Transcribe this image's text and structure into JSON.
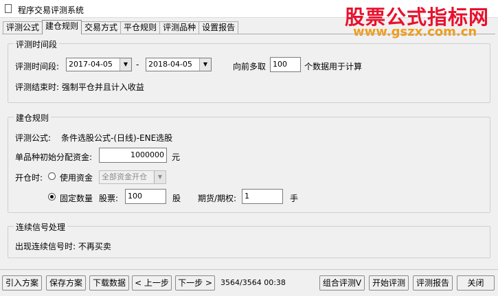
{
  "window": {
    "title": "程序交易评测系统"
  },
  "watermark": {
    "text": "股票公式指标网",
    "url": "www.gszx.com.cn"
  },
  "tabs": [
    {
      "label": "评测公式"
    },
    {
      "label": "建仓规则"
    },
    {
      "label": "交易方式"
    },
    {
      "label": "平仓规则"
    },
    {
      "label": "评测品种"
    },
    {
      "label": "设置报告"
    }
  ],
  "period_group": {
    "title": "评测时间段",
    "range_label": "评测时间段:",
    "start_date": "2017-04-05",
    "separator": "-",
    "end_date": "2018-04-05",
    "lookback_prefix": "向前多取",
    "lookback_value": "100",
    "lookback_suffix": "个数据用于计算",
    "end_text": "评测结束时: 强制平仓并且计入收益"
  },
  "build_group": {
    "title": "建仓规则",
    "formula_label": "评测公式:",
    "formula_value": "条件选股公式-(日线)-ENE选股",
    "capital_label": "单品种初始分配资金:",
    "capital_value": "1000000",
    "capital_unit": "元",
    "open_label": "开仓时:",
    "use_capital_label": "使用资金",
    "use_capital_select": "全部资金开仓",
    "use_capital_checked": false,
    "fixed_qty_label": "固定数量",
    "fixed_qty_checked": true,
    "stock_label": "股票:",
    "stock_value": "100",
    "stock_unit": "股",
    "futures_label": "期货/期权:",
    "futures_value": "1",
    "futures_unit": "手"
  },
  "signal_group": {
    "title": "连续信号处理",
    "text": "出现连续信号时: 不再买卖"
  },
  "footer": {
    "import_label": "引入方案",
    "save_label": "保存方案",
    "download_label": "下载数据",
    "prev_label": "< 上一步",
    "next_label": "下一步 >",
    "status": "3564/3564 00:38",
    "combo_eval_label": "组合评测V",
    "start_eval_label": "开始评测",
    "report_label": "评测报告",
    "close_label": "关闭"
  }
}
